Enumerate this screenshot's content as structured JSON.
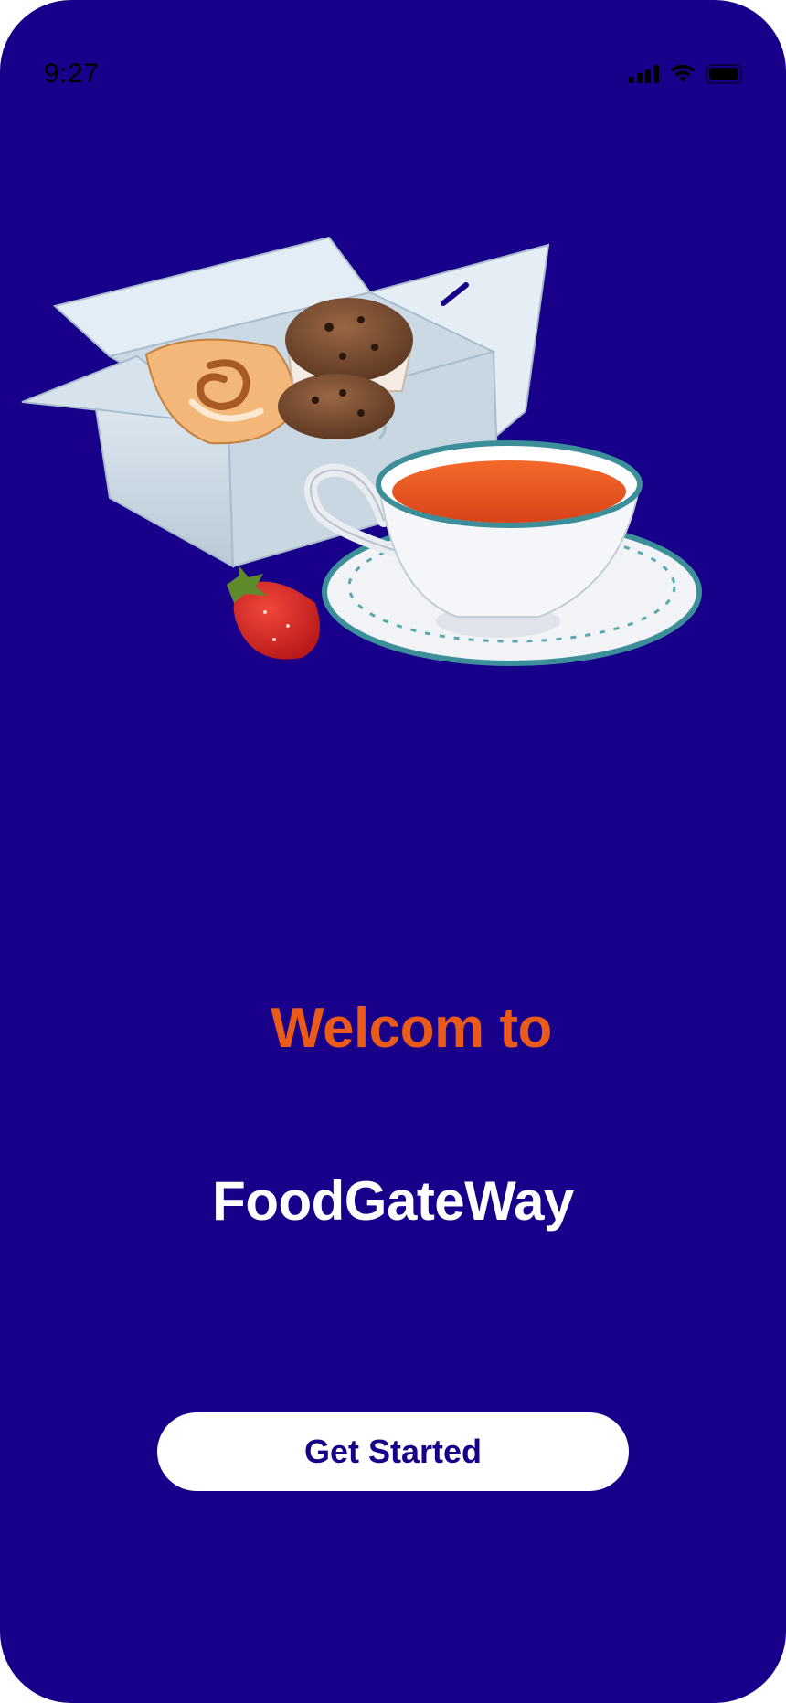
{
  "status_bar": {
    "time": "9:27",
    "icons": [
      "signal-icon",
      "wifi-icon",
      "battery-icon"
    ]
  },
  "hero": {
    "illustration": "pastry-box-teacup-illustration"
  },
  "welcome": {
    "title": "Welcom to",
    "app_name": "FoodGateWay"
  },
  "actions": {
    "get_started_label": "Get Started"
  },
  "colors": {
    "background": "#18008b",
    "accent": "#ea5a18",
    "button_bg": "#ffffff",
    "button_text": "#18008b"
  }
}
